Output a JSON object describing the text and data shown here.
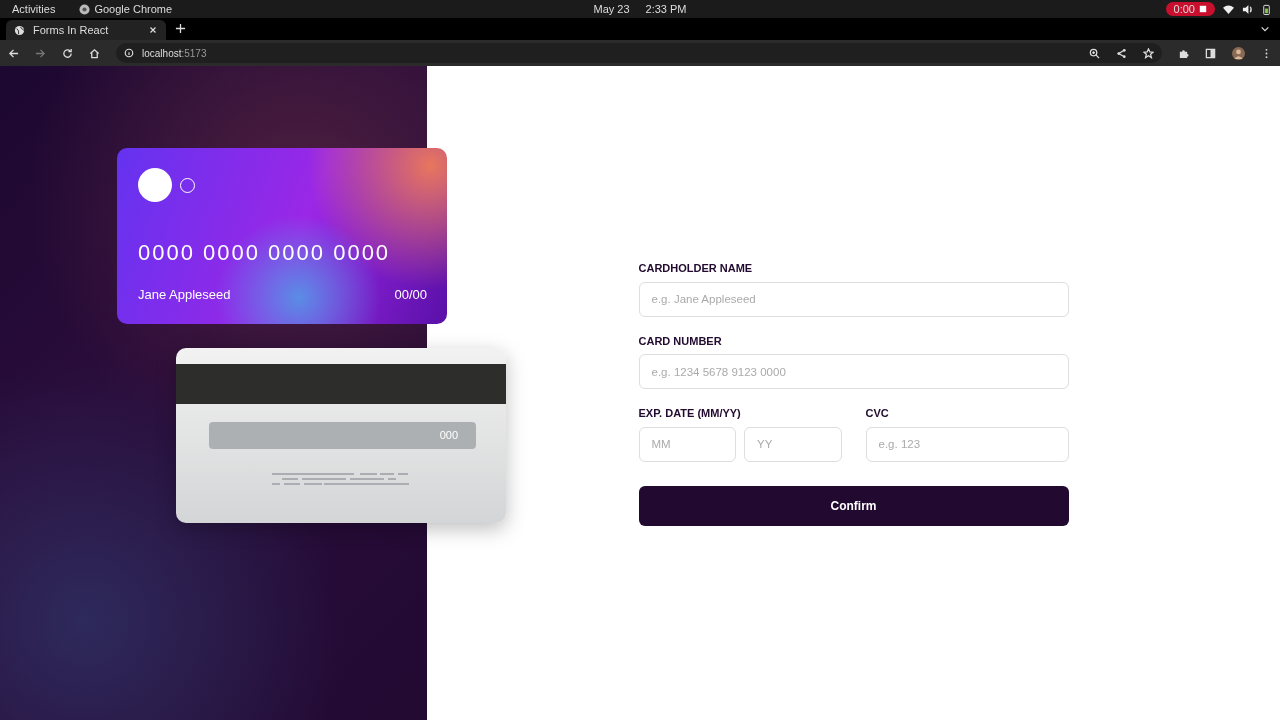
{
  "os_bar": {
    "activities": "Activities",
    "app_name": "Google Chrome",
    "date": "May 23",
    "time": "2:33 PM",
    "recording": "0:00"
  },
  "browser": {
    "tab_title": "Forms In React",
    "url_host": "localhost",
    "url_port": ":5173"
  },
  "card_front": {
    "number": "0000 0000 0000 0000",
    "name": "Jane Appleseed",
    "expiry": "00/00"
  },
  "card_back": {
    "cvc": "000"
  },
  "form": {
    "rows": [
      [
        {
          "label": "CARDHOLDER NAME",
          "inputs": [
            {
              "placeholder": "e.g. Jane Appleseed"
            }
          ]
        }
      ],
      [
        {
          "label": "CARD NUMBER",
          "inputs": [
            {
              "placeholder": "e.g. 1234 5678 9123 0000"
            }
          ]
        }
      ],
      [
        {
          "label": "EXP. DATE (MM/YY)",
          "inputs": [
            {
              "placeholder": "MM"
            },
            {
              "placeholder": "YY"
            }
          ]
        },
        {
          "label": "CVC",
          "inputs": [
            {
              "placeholder": "e.g. 123"
            }
          ]
        }
      ]
    ],
    "button": "Confirm"
  }
}
